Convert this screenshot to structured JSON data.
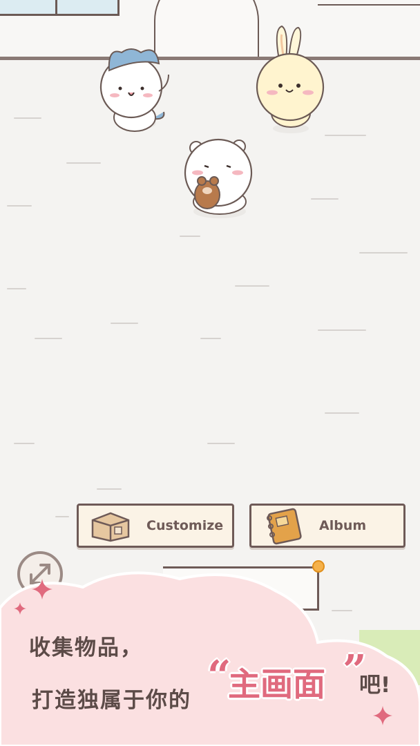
{
  "menu": {
    "customize_label": "Customize",
    "album_label": "Album"
  },
  "promo": {
    "line1": "收集物品，",
    "line2": "打造独属于你的",
    "highlight": "主画面",
    "quote_open": "“",
    "quote_close": "”",
    "ending": "吧!"
  },
  "icons": {
    "customize": "box-icon",
    "album": "notebook-icon",
    "expand": "expand-arrows-icon"
  },
  "colors": {
    "accent_pink": "#e06a7e",
    "text_brown": "#5c4b48",
    "button_bg": "#fbf3e6",
    "notification": "#f5b14a"
  }
}
